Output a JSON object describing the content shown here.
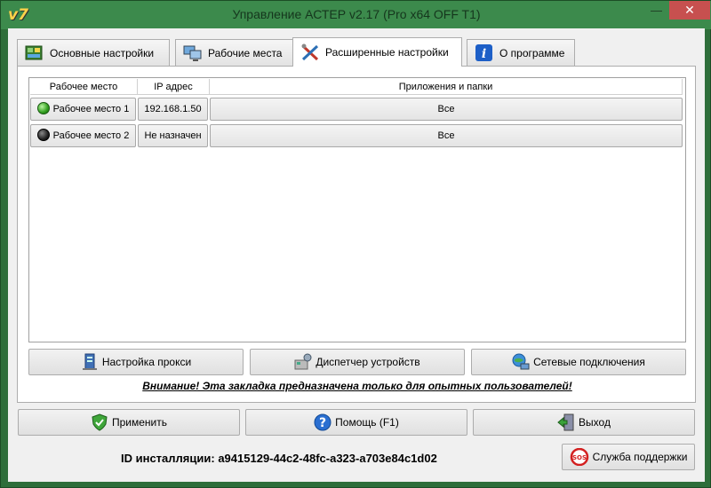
{
  "window": {
    "title": "Управление АСТЕР v2.17 (Pro x64 OFF T1)",
    "app_icon": "v7",
    "controls": {
      "minimize": "—",
      "maximize": "□",
      "close": "✕"
    }
  },
  "tabs": [
    {
      "label": "Основные настройки",
      "icon": "settings-board-icon",
      "active": false
    },
    {
      "label": "Рабочие места",
      "icon": "workstations-icon",
      "active": false
    },
    {
      "label": "Расширенные настройки",
      "icon": "tools-icon",
      "active": true
    },
    {
      "label": "О программе",
      "icon": "info-icon",
      "active": false
    }
  ],
  "grid": {
    "headers": [
      "Рабочее место",
      "IP адрес",
      "Приложения и папки"
    ],
    "rows": [
      {
        "workplace": "Рабочее место 1",
        "status": "green",
        "ip": "192.168.1.50",
        "apps": "Все"
      },
      {
        "workplace": "Рабочее место 2",
        "status": "black",
        "ip": "Не назначен",
        "apps": "Все"
      }
    ]
  },
  "panel_buttons": {
    "proxy": "Настройка прокси",
    "device_manager": "Диспетчер устройств",
    "network": "Сетевые подключения"
  },
  "warning": "Внимание! Эта закладка предназначена только для опытных пользователей!",
  "footer": {
    "apply": "Применить",
    "help": "Помощь (F1)",
    "exit": "Выход",
    "install_id_label": "ID инсталляции:",
    "install_id": "a9415129-44c2-48fc-a323-a703e84c1d02",
    "support": "Служба поддержки",
    "support_icon_text": "SOS"
  },
  "colors": {
    "window_frame": "#3c8a4c",
    "close_button": "#c7504f",
    "status_online": "#2f9d1d",
    "status_offline": "#222222"
  }
}
